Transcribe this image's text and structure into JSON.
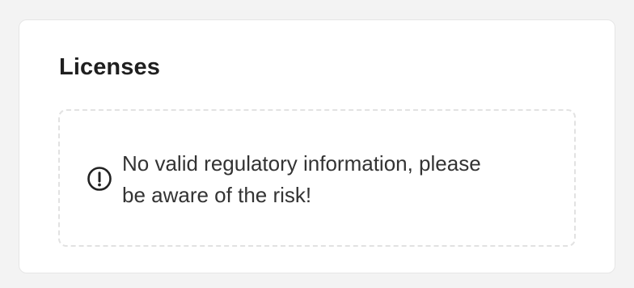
{
  "licenses": {
    "title": "Licenses",
    "notice": {
      "icon": "exclamation-circle-icon",
      "text_line_1": "No valid regulatory information, please",
      "text_line_2": "be aware of the risk!"
    }
  },
  "colors": {
    "page_background": "#f3f3f3",
    "card_background": "#ffffff",
    "card_border": "#e6e6e6",
    "dashed_border": "#e2e2e2",
    "title_text": "#1f1f1f",
    "body_text": "#333333"
  }
}
